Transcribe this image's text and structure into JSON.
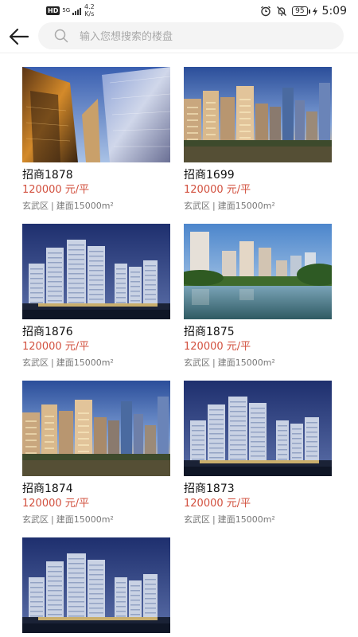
{
  "status_bar": {
    "hd": "HD",
    "signal": "5G",
    "speed_value": "4.2",
    "speed_unit": "K/s",
    "battery": "95",
    "time": "5:09"
  },
  "header": {
    "search_placeholder": "输入您想搜索的楼盘"
  },
  "listings": [
    {
      "name": "招商1878",
      "price": "120000 元/平",
      "district": "玄武区",
      "area": "建面15000m²",
      "image": "glass-towers"
    },
    {
      "name": "招商1699",
      "price": "120000 元/平",
      "district": "玄武区",
      "area": "建面15000m²",
      "image": "city-dusk"
    },
    {
      "name": "招商1876",
      "price": "120000 元/平",
      "district": "玄武区",
      "area": "建面15000m²",
      "image": "night-towers"
    },
    {
      "name": "招商1875",
      "price": "120000 元/平",
      "district": "玄武区",
      "area": "建面15000m²",
      "image": "lake-towers"
    },
    {
      "name": "招商1874",
      "price": "120000 元/平",
      "district": "玄武区",
      "area": "建面15000m²",
      "image": "city-dusk"
    },
    {
      "name": "招商1873",
      "price": "120000 元/平",
      "district": "玄武区",
      "area": "建面15000m²",
      "image": "night-towers"
    },
    {
      "name": "",
      "price": "",
      "district": "",
      "area": "",
      "image": "night-towers"
    }
  ],
  "colors": {
    "price": "#d2503e",
    "search_bg": "#f4f4f4"
  }
}
